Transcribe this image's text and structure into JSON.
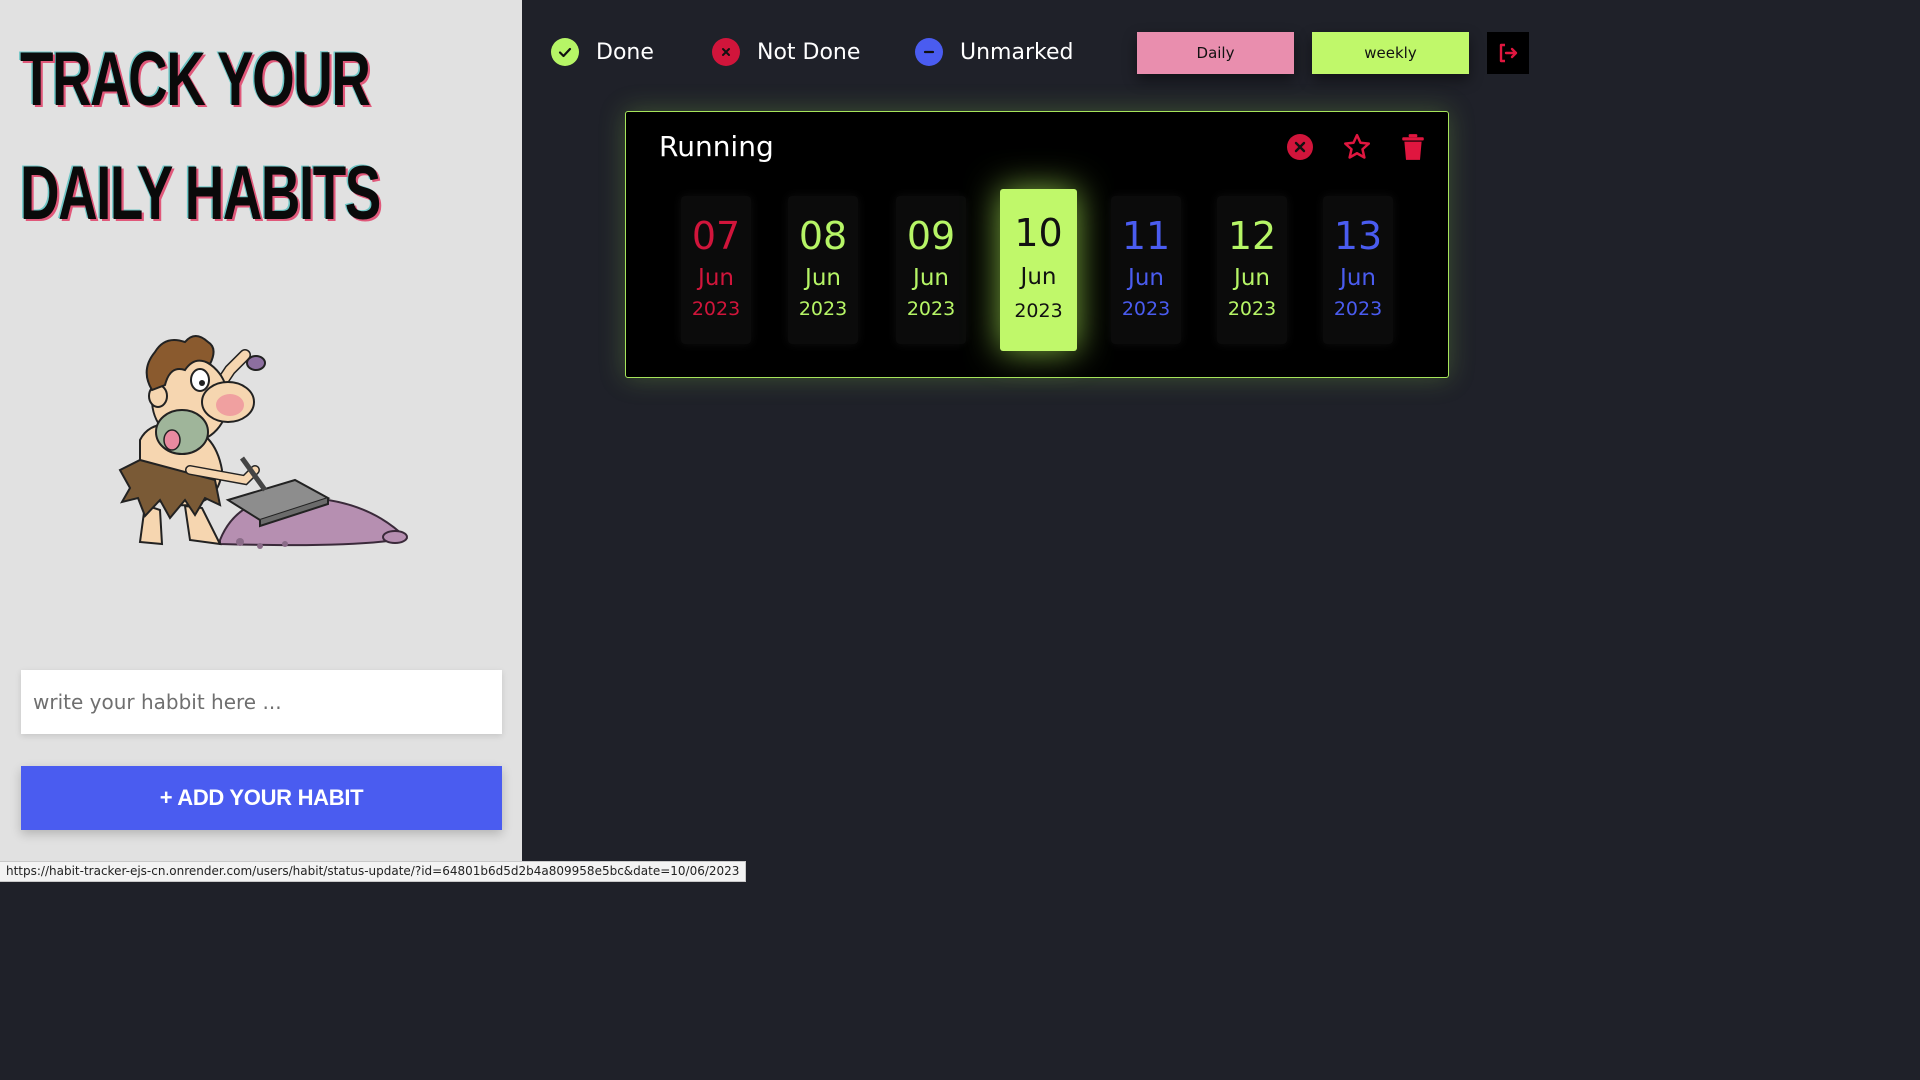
{
  "sidebar": {
    "title_line1": "TRACK YOUR",
    "title_line2": "DAILY  HABITS",
    "input_placeholder": "write your habbit here ...",
    "add_button_label": "+ ADD YOUR HABIT"
  },
  "legend": {
    "done": {
      "label": "Done",
      "color": "#b6f566",
      "icon": "check-icon"
    },
    "not_done": {
      "label": "Not Done",
      "color": "#d1153b",
      "icon": "x-icon"
    },
    "unmarked": {
      "label": "Unmarked",
      "color": "#4a5cf0",
      "icon": "minus-icon"
    }
  },
  "nav": {
    "daily_label": "Daily",
    "weekly_label": "weekly",
    "logout_icon": "logout-icon"
  },
  "habit": {
    "name": "Running",
    "actions": [
      "x-circle-icon",
      "star-icon",
      "trash-icon"
    ],
    "days": [
      {
        "day": "07",
        "month": "Jun",
        "year": "2023",
        "status": "not_done",
        "color": "#d1153b"
      },
      {
        "day": "08",
        "month": "Jun",
        "year": "2023",
        "status": "done",
        "color": "#b6f566"
      },
      {
        "day": "09",
        "month": "Jun",
        "year": "2023",
        "status": "done",
        "color": "#b6f566"
      },
      {
        "day": "10",
        "month": "Jun",
        "year": "2023",
        "status": "selected",
        "color": "#111111"
      },
      {
        "day": "11",
        "month": "Jun",
        "year": "2023",
        "status": "unmarked",
        "color": "#4a5cf0"
      },
      {
        "day": "12",
        "month": "Jun",
        "year": "2023",
        "status": "done",
        "color": "#b6f566"
      },
      {
        "day": "13",
        "month": "Jun",
        "year": "2023",
        "status": "unmarked",
        "color": "#4a5cf0"
      }
    ]
  },
  "status_bar": {
    "url": "https://habit-tracker-ejs-cn.onrender.com/users/habit/status-update/?id=64801b6d5d2b4a809958e5bc&date=10/06/2023"
  }
}
